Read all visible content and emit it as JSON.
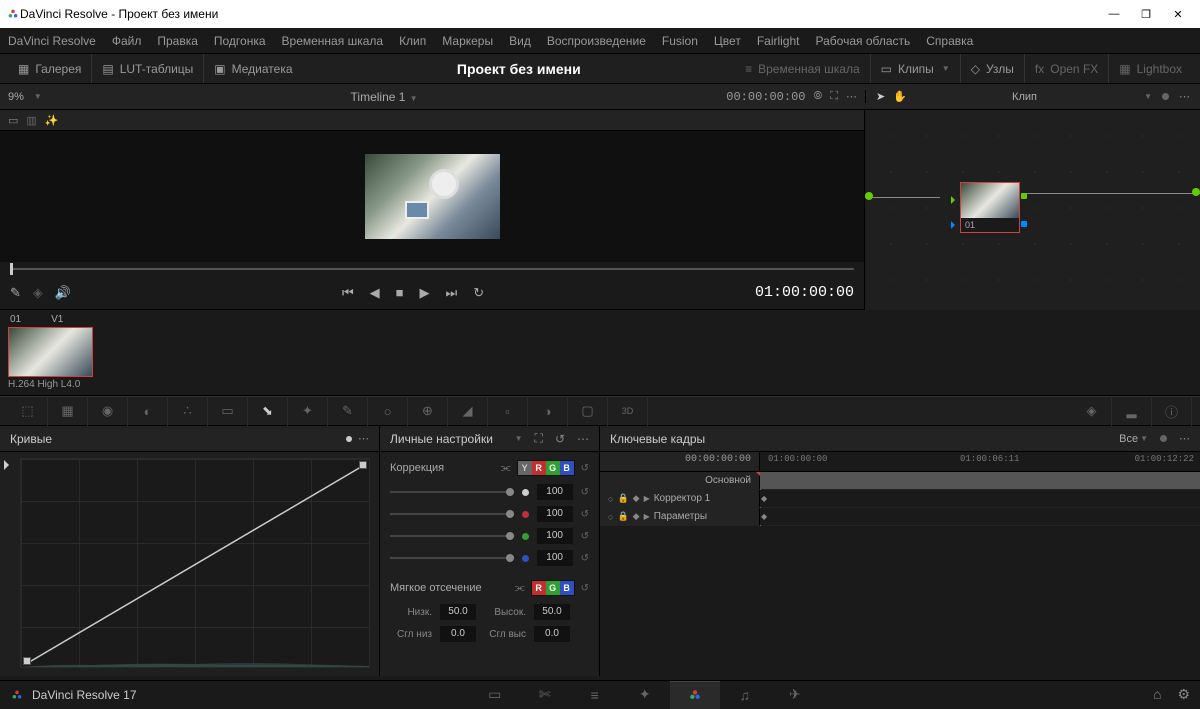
{
  "window": {
    "title": "DaVinci Resolve - Проект без имени"
  },
  "menu": [
    "DaVinci Resolve",
    "Файл",
    "Правка",
    "Подгонка",
    "Временная шкала",
    "Клип",
    "Маркеры",
    "Вид",
    "Воспроизведение",
    "Fusion",
    "Цвет",
    "Fairlight",
    "Рабочая область",
    "Справка"
  ],
  "toolbar": {
    "gallery": "Галерея",
    "luts": "LUT-таблицы",
    "media": "Медиатека",
    "project": "Проект без имени",
    "timeline_mode": "Временная шкала",
    "clips": "Клипы",
    "nodes": "Узлы",
    "openfx": "Open FX",
    "lightbox": "Lightbox"
  },
  "sub": {
    "zoom": "9%",
    "timeline_name": "Timeline 1",
    "timecode": "00:00:00:00",
    "clip_label": "Клип"
  },
  "transport": {
    "timecode": "01:00:00:00"
  },
  "clip": {
    "num": "01",
    "track": "V1",
    "codec": "H.264 High L4.0"
  },
  "node": {
    "label": "01"
  },
  "curves": {
    "title": "Кривые",
    "mode": "Личные настройки",
    "correction": "Коррекция",
    "softclip": "Мягкое отсечение",
    "values": [
      "100",
      "100",
      "100",
      "100"
    ],
    "low_lbl": "Низк.",
    "low": "50.0",
    "high_lbl": "Высок.",
    "high": "50.0",
    "ls_lbl": "Сгл низ",
    "ls": "0.0",
    "hs_lbl": "Сгл выс",
    "hs": "0.0",
    "channels": [
      "Y",
      "R",
      "G",
      "B"
    ]
  },
  "keyframes": {
    "title": "Ключевые кадры",
    "filter": "Все",
    "tc_start": "00:00:00:00",
    "tc_0": "01:00:00:00",
    "tc_1": "01:00:06:11",
    "tc_2": "01:00:12:22",
    "master": "Основной",
    "corrector": "Корректор 1",
    "params": "Параметры"
  },
  "bottom": {
    "app": "DaVinci Resolve 17"
  }
}
